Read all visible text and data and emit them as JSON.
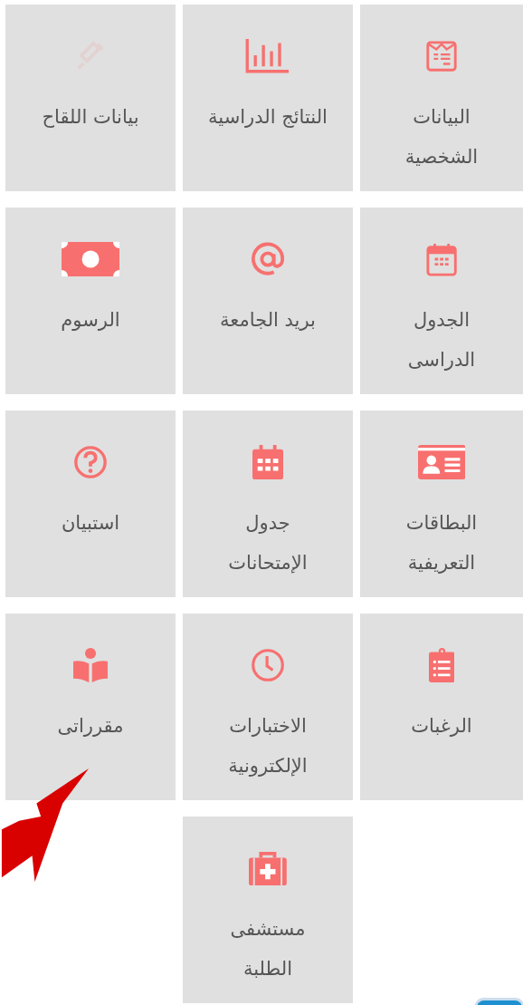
{
  "tiles": [
    {
      "label": "البيانات\nالشخصية",
      "kind": "form",
      "dimmed": false
    },
    {
      "label": "النتائج الدراسية",
      "kind": "chart",
      "dimmed": false
    },
    {
      "label": "بيانات اللقاح",
      "kind": "syringe",
      "dimmed": true
    },
    {
      "label": "الجدول\nالدراسى",
      "kind": "calendar",
      "dimmed": false
    },
    {
      "label": "بريد الجامعة",
      "kind": "at",
      "dimmed": false
    },
    {
      "label": "الرسوم",
      "kind": "money",
      "dimmed": false
    },
    {
      "label": "البطاقات\nالتعريفية",
      "kind": "idcard",
      "dimmed": false
    },
    {
      "label": "جدول\nالإمتحانات",
      "kind": "grid",
      "dimmed": false
    },
    {
      "label": "استبيان",
      "kind": "question",
      "dimmed": false
    },
    {
      "label": "الرغبات",
      "kind": "clipboard",
      "dimmed": false
    },
    {
      "label": "الاختبارات\nالإلكترونية",
      "kind": "clock",
      "dimmed": false
    },
    {
      "label": "مقرراتى",
      "kind": "reader",
      "dimmed": false
    },
    {
      "label": "مستشفى\nالطلبة",
      "kind": "medkit",
      "dimmed": false
    }
  ]
}
